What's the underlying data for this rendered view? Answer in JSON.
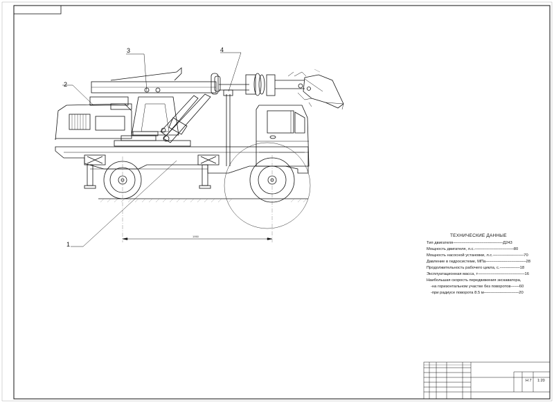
{
  "callouts": {
    "c1": "1",
    "c2": "2",
    "c3": "3",
    "c4": "4"
  },
  "dimension": {
    "track": "1950"
  },
  "specs": {
    "title": "ТЕХНИЧЕСКИЕ ДАННЫЕ",
    "rows": [
      {
        "label": "Тип двигателя",
        "value": "Д243"
      },
      {
        "label": "Мощность двигателя, л.с.",
        "value": "80"
      },
      {
        "label": "Мощность насосной установки, л.с.",
        "value": "70"
      },
      {
        "label": "Давление в гидросистеме, МПа",
        "value": "28"
      },
      {
        "label": "Продолжительность рабочего цикла, с.",
        "value": "18"
      },
      {
        "label": "Эксплуатационная масса, т",
        "value": "16"
      },
      {
        "label": "Наибольшая скорость передвижения экскаватора,",
        "value": ""
      },
      {
        "label": "-на горизонтальном участке без поворотов",
        "value": "60"
      },
      {
        "label": "-при радиусе поворота 8.5 м",
        "value": "20"
      }
    ]
  },
  "title_block": {
    "sheet": "Н 7",
    "scale": "1:20"
  }
}
